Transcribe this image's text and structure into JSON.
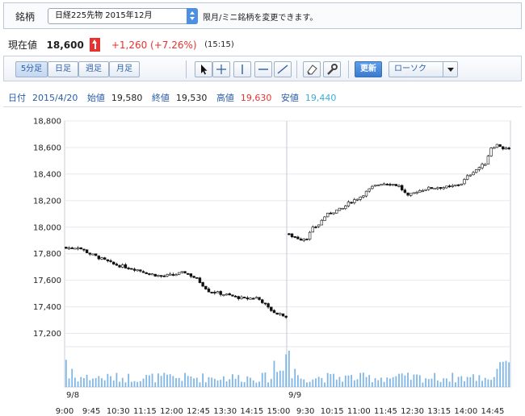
{
  "symbol_bar": {
    "label": "銘柄",
    "selected": "日経225先物 2015年12月",
    "hint": "限月/ミニ銘柄を変更できます。"
  },
  "price": {
    "label": "現在値",
    "value": "18,600",
    "change": "+1,260 (+7.26%)",
    "time": "(15:15)",
    "up_color": "#e8322e"
  },
  "toolbar": {
    "periods": [
      "5分足",
      "日足",
      "週足",
      "月足"
    ],
    "active_period": "5分足",
    "tools": [
      "cursor-arrow-icon",
      "crosshair-icon",
      "vertical-line-icon",
      "horizontal-line-icon",
      "trend-line-icon",
      "eraser-icon",
      "settings-wrench-icon"
    ],
    "update_label": "更新",
    "chart_type": "ローソク"
  },
  "ohlc": {
    "date_label": "日付",
    "date": "2015/4/20",
    "open_label": "始値",
    "open": "19,580",
    "close_label": "終値",
    "close": "19,530",
    "high_label": "高値",
    "high": "19,630",
    "low_label": "安値",
    "low": "19,440"
  },
  "chart_data": {
    "type": "candlestick",
    "ylim": [
      17100,
      18800
    ],
    "yticks": [
      17200,
      17400,
      17600,
      17800,
      18000,
      18200,
      18400,
      18600,
      18800
    ],
    "ytick_labels": [
      "17,200",
      "17,400",
      "17,600",
      "17,800",
      "18,000",
      "18,200",
      "18,400",
      "18,600",
      "18,800"
    ],
    "xtick_labels": [
      "9:00",
      "9:45",
      "10:30",
      "11:15",
      "12:00",
      "12:45",
      "13:30",
      "14:15",
      "15:00",
      "9:30",
      "10:15",
      "11:00",
      "11:45",
      "12:30",
      "13:15",
      "14:00",
      "14:45"
    ],
    "day_labels": [
      "9/8",
      "9/9"
    ],
    "bars_per_day": 75,
    "day1_close_path": [
      [
        0,
        17840
      ],
      [
        4,
        17850
      ],
      [
        8,
        17800
      ],
      [
        12,
        17760
      ],
      [
        16,
        17720
      ],
      [
        20,
        17700
      ],
      [
        24,
        17680
      ],
      [
        28,
        17650
      ],
      [
        32,
        17630
      ],
      [
        36,
        17640
      ],
      [
        40,
        17660
      ],
      [
        44,
        17610
      ],
      [
        48,
        17520
      ],
      [
        52,
        17500
      ],
      [
        56,
        17480
      ],
      [
        60,
        17460
      ],
      [
        64,
        17470
      ],
      [
        66,
        17440
      ],
      [
        68,
        17390
      ],
      [
        70,
        17360
      ],
      [
        72,
        17350
      ],
      [
        74,
        17330
      ]
    ],
    "day2_close_path": [
      [
        0,
        17940
      ],
      [
        4,
        17910
      ],
      [
        6,
        17920
      ],
      [
        8,
        17990
      ],
      [
        10,
        18020
      ],
      [
        12,
        18080
      ],
      [
        14,
        18110
      ],
      [
        18,
        18140
      ],
      [
        20,
        18180
      ],
      [
        24,
        18230
      ],
      [
        28,
        18300
      ],
      [
        31,
        18330
      ],
      [
        34,
        18330
      ],
      [
        37,
        18310
      ],
      [
        40,
        18230
      ],
      [
        43,
        18270
      ],
      [
        46,
        18290
      ],
      [
        50,
        18300
      ],
      [
        54,
        18300
      ],
      [
        58,
        18330
      ],
      [
        60,
        18380
      ],
      [
        62,
        18420
      ],
      [
        64,
        18450
      ],
      [
        66,
        18480
      ],
      [
        68,
        18600
      ],
      [
        70,
        18620
      ],
      [
        72,
        18590
      ],
      [
        74,
        18600
      ]
    ],
    "volume_range": [
      0,
      1
    ]
  }
}
